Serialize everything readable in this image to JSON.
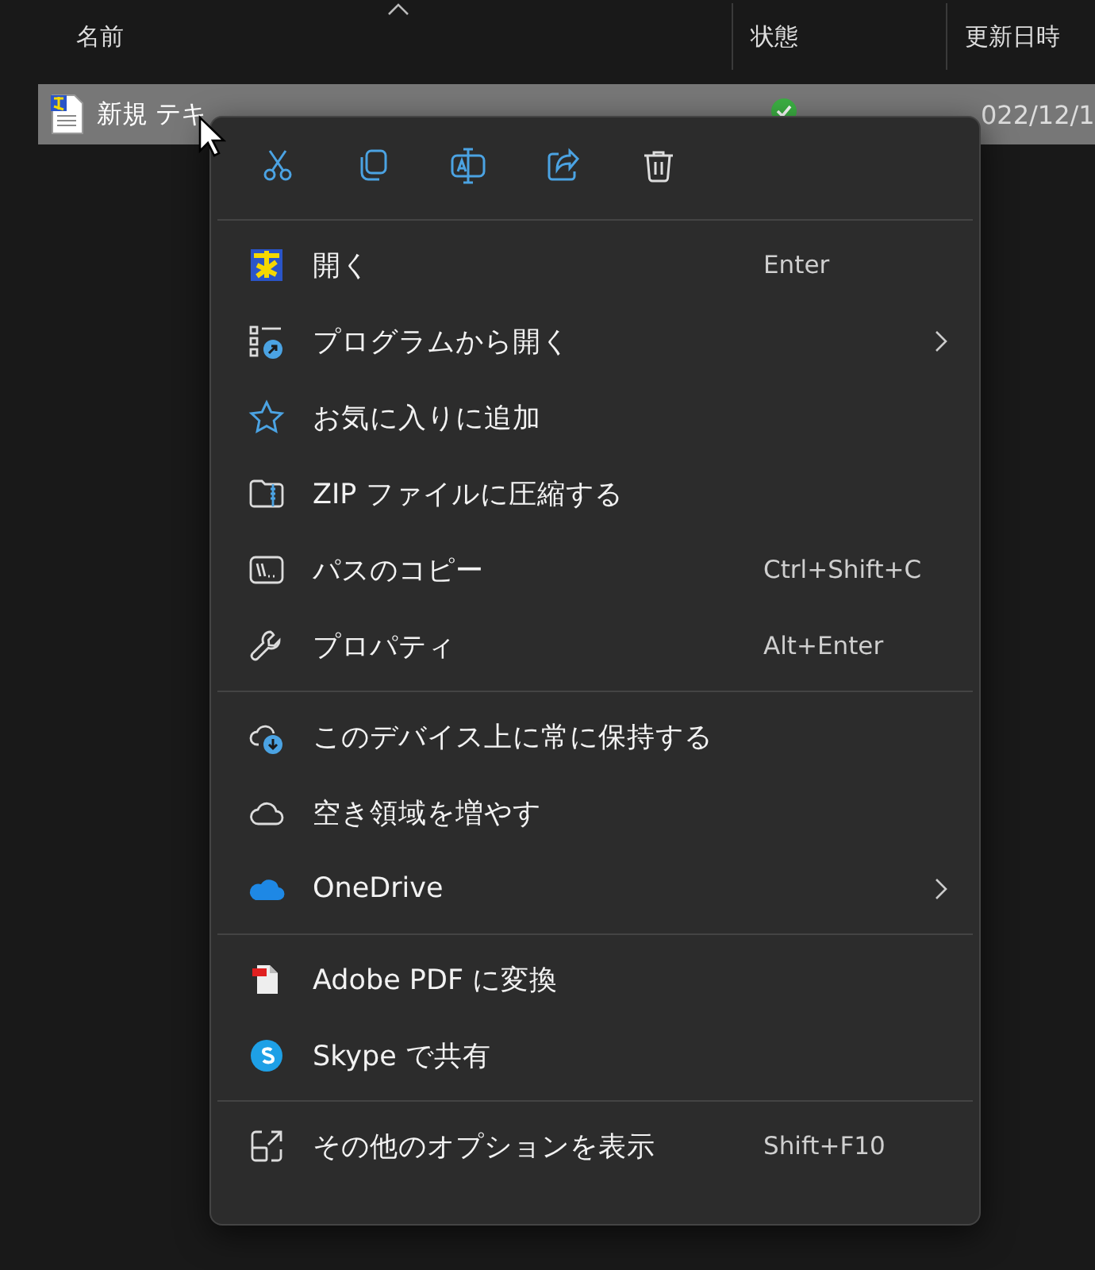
{
  "columns": [
    {
      "label": "名前",
      "sorted": true
    },
    {
      "label": "状態",
      "sorted": false
    },
    {
      "label": "更新日時",
      "sorted": false
    }
  ],
  "file": {
    "name": "新規 テキ",
    "synced": true,
    "modified": "022/12/1",
    "selected": true
  },
  "menu": {
    "groups": [
      [
        {
          "label": "開く",
          "shortcut": "Enter",
          "submenu": false
        },
        {
          "label": "プログラムから開く",
          "submenu": true
        },
        {
          "label": "お気に入りに追加",
          "submenu": false
        },
        {
          "label": "ZIP ファイルに圧縮する",
          "submenu": false
        },
        {
          "label": "パスのコピー",
          "shortcut": "Ctrl+Shift+C",
          "submenu": false
        },
        {
          "label": "プロパティ",
          "shortcut": "Alt+Enter",
          "submenu": false
        }
      ],
      [
        {
          "label": "このデバイス上に常に保持する",
          "submenu": false
        },
        {
          "label": "空き領域を増やす",
          "submenu": false
        },
        {
          "label": "OneDrive",
          "submenu": true
        }
      ],
      [
        {
          "label": "Adobe PDF に変換",
          "submenu": false
        },
        {
          "label": "Skype で共有",
          "submenu": false
        }
      ],
      [
        {
          "label": "その他のオプションを表示",
          "shortcut": "Shift+F10",
          "submenu": false
        }
      ]
    ]
  }
}
